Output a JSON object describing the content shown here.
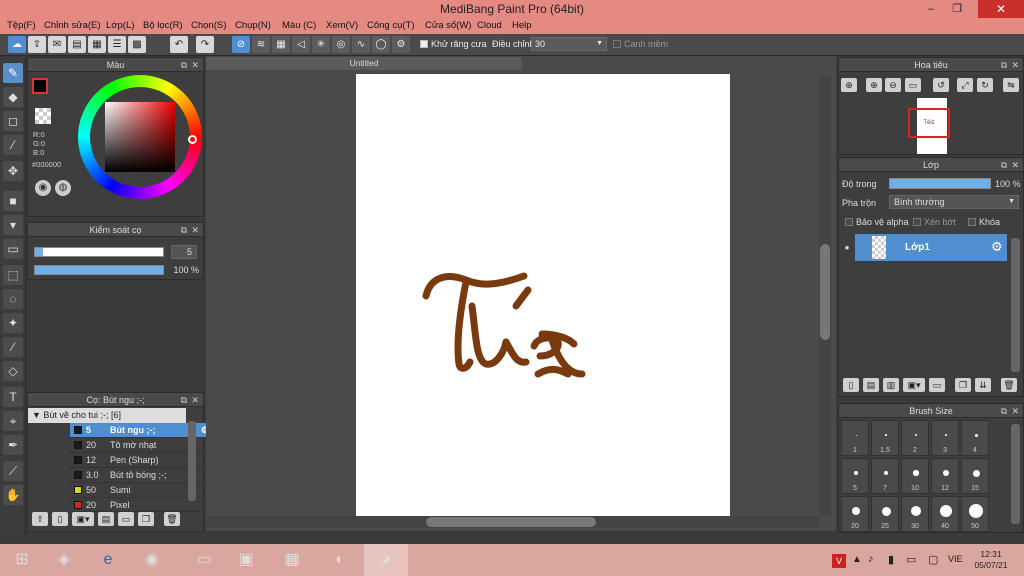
{
  "window": {
    "title": "MediBang Paint Pro (64bit)",
    "minimize": "–",
    "maximize": "❐",
    "close": "✕"
  },
  "menu": [
    "Tệp(F)",
    "Chỉnh sửa(E)",
    "Lớp(L)",
    "Bộ lọc(R)",
    "Chọn(S)",
    "Chụp(N)",
    "Màu (C)",
    "Xem(V)",
    "Công cụ(T)",
    "Cửa sổ(W)",
    "Cloud",
    "Help"
  ],
  "toolbar": {
    "antialias_label": "Khử răng cưa",
    "adjust_label": "Điều chỉnh",
    "adjust_value": "30",
    "snap_label": "Canh mềm"
  },
  "color_panel": {
    "title": "Màu",
    "r": "R:0",
    "g": "G:0",
    "b": "B:0",
    "hex": "#000000"
  },
  "brush_control": {
    "title": "Kiểm soát cọ",
    "size_value": "5",
    "opacity_value": "100 %"
  },
  "brush_list": {
    "title": "Cọ: Bút ngu ;-;",
    "group": "Bút vẽ cho tui ;-; [6]",
    "items": [
      {
        "size": "5",
        "name": "Bút ngu ;-;",
        "color": "#1a1a1a",
        "selected": true
      },
      {
        "size": "20",
        "name": "Tô mờ nhạt",
        "color": "#1a1a1a",
        "selected": false
      },
      {
        "size": "12",
        "name": "Pen (Sharp)",
        "color": "#1a1a1a",
        "selected": false
      },
      {
        "size": "3.0",
        "name": "Bút tô bóng ;-;",
        "color": "#1a1a1a",
        "selected": false
      },
      {
        "size": "50",
        "name": "Sumi",
        "color": "#e6d21c",
        "selected": false
      },
      {
        "size": "20",
        "name": "Pixel",
        "color": "#d22",
        "selected": false
      }
    ]
  },
  "canvas": {
    "tab": "Untitled",
    "drawing_text": "Téiz",
    "ink_color": "#7a3a10"
  },
  "navigator": {
    "title": "Hoa tiêu"
  },
  "layer_panel": {
    "title": "Lớp",
    "opacity_label": "Độ trong",
    "opacity_value": "100 %",
    "blend_label": "Pha trộn",
    "blend_value": "Bình thường",
    "protect_alpha": "Bảo vệ alpha",
    "clipping": "Xén bớt",
    "lock": "Khóa",
    "layer_name": "Lớp1"
  },
  "brush_size": {
    "title": "Brush Size",
    "sizes": [
      "1",
      "1.5",
      "2",
      "3",
      "4",
      "5",
      "7",
      "10",
      "12",
      "15",
      "20",
      "25",
      "30",
      "40",
      "50"
    ]
  },
  "taskbar": {
    "lang": "VIE",
    "time": "12:31",
    "date": "05/07/21"
  },
  "colors": {
    "accent": "#4f8fd0",
    "title_bg": "#e58a83",
    "taskbar_bg": "#d9a6a0"
  }
}
